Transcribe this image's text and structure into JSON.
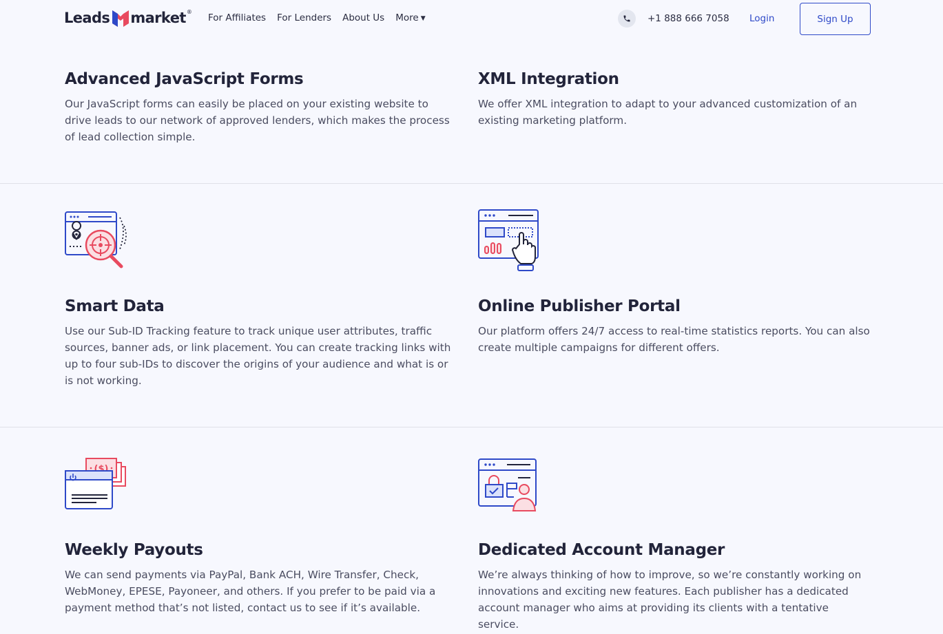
{
  "header": {
    "logo_left": "Leads",
    "logo_right": "market",
    "logo_reg": "®",
    "nav": [
      {
        "label": "For Affiliates"
      },
      {
        "label": "For Lenders"
      },
      {
        "label": "About Us"
      },
      {
        "label": "More"
      }
    ],
    "phone_icon": "phone-icon",
    "phone": "+1 888 666 7058",
    "login": "Login",
    "signup": "Sign Up"
  },
  "colors": {
    "accent": "#2e49c8",
    "brand_red": "#e84a5f",
    "background": "#f7f8fe"
  },
  "features": [
    {
      "title": "Advanced JavaScript Forms",
      "text": "Our JavaScript forms can easily be placed on your existing website to drive leads to our network of approved lenders, which makes the process of lead collection simple."
    },
    {
      "title": "XML Integration",
      "text": "We offer XML integration to adapt to your advanced customization of an existing marketing platform."
    },
    {
      "title": "Smart Data",
      "icon": "location-target-icon",
      "text": "Use our Sub-ID Tracking feature to track unique user attributes, traffic sources, banner ads, or link placement. You can create tracking links with up to four sub-IDs to discover the origins of your audience and what is or is not working."
    },
    {
      "title": "Online Publisher Portal",
      "icon": "dashboard-click-icon",
      "text": "Our platform offers 24/7 access to real-time statistics reports. You can also create multiple campaigns for different offers."
    },
    {
      "title": "Weekly Payouts",
      "icon": "payment-card-icon",
      "text": "We can send payments via PayPal, Bank ACH, Wire Transfer, Check, WebMoney, EPESE, Payoneer, and others. If you prefer to be paid via a payment method that’s not listed, contact us to see if it’s available."
    },
    {
      "title": "Dedicated Account Manager",
      "icon": "account-manager-icon",
      "text": "We’re always thinking of how to improve, so we’re constantly working on innovations and exciting new features. Each publisher has a dedicated account manager who aims at providing its clients with a tentative service."
    }
  ]
}
